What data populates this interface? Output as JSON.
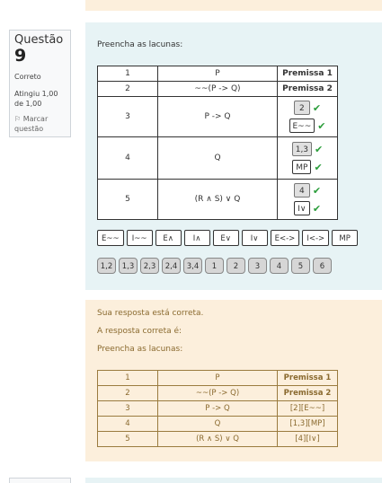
{
  "question": {
    "label": "Questão",
    "number": "9",
    "state": "Correto",
    "grade": "Atingiu 1,00 de 1,00",
    "flag_label": "Marcar questão",
    "flag_icon": "flag-icon"
  },
  "prompt": "Preencha as lacunas:",
  "table": {
    "rows": [
      {
        "n": "1",
        "formula": "P",
        "just": "Premissa 1"
      },
      {
        "n": "2",
        "formula": "~~(P -> Q)",
        "just": "Premissa 2"
      },
      {
        "n": "3",
        "formula": "P -> Q",
        "answers": [
          "2",
          "E~~"
        ]
      },
      {
        "n": "4",
        "formula": "Q",
        "answers": [
          "1,3",
          "MP"
        ]
      },
      {
        "n": "5",
        "formula": "(R ∧ S) ∨ Q",
        "answers": [
          "4",
          "I∨"
        ]
      }
    ]
  },
  "drag_rules": [
    "E~~",
    "I~~",
    "E∧",
    "I∧",
    "E∨",
    "I∨",
    "E<->",
    "I<->",
    "MP"
  ],
  "drag_lines": [
    "1,2",
    "1,3",
    "2,3",
    "2,4",
    "3,4",
    "1",
    "2",
    "3",
    "4",
    "5",
    "6"
  ],
  "feedback": {
    "correct_msg": "Sua resposta está correta.",
    "correct_answer_label": "A resposta correta é:",
    "prompt": "Preencha as lacunas:",
    "rows": [
      {
        "n": "1",
        "formula": "P",
        "just": "Premissa 1"
      },
      {
        "n": "2",
        "formula": "~~(P -> Q)",
        "just": "Premissa 2"
      },
      {
        "n": "3",
        "formula": "P -> Q",
        "just": "[2][E~~]"
      },
      {
        "n": "4",
        "formula": "Q",
        "just": "[1,3][MP]"
      },
      {
        "n": "5",
        "formula": "(R ∧ S) ∨ Q",
        "just": "[4][I∨]"
      }
    ]
  },
  "colors": {
    "content_bg": "#e7f3f5",
    "feedback_bg": "#fcefdc",
    "feedback_text": "#8a6a2f",
    "check": "#2a9d3a"
  }
}
